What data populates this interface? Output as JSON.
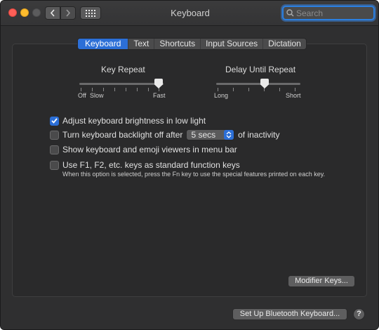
{
  "window": {
    "title": "Keyboard"
  },
  "search": {
    "placeholder": "Search"
  },
  "tabs": [
    {
      "label": "Keyboard",
      "active": true
    },
    {
      "label": "Text",
      "active": false
    },
    {
      "label": "Shortcuts",
      "active": false
    },
    {
      "label": "Input Sources",
      "active": false
    },
    {
      "label": "Dictation",
      "active": false
    }
  ],
  "key_repeat": {
    "title": "Key Repeat",
    "label_off": "Off",
    "label_slow": "Slow",
    "label_fast": "Fast",
    "level": "7 of 8"
  },
  "delay_until_repeat": {
    "title": "Delay Until Repeat",
    "label_long": "Long",
    "label_short": "Short",
    "level": "4 of 6"
  },
  "options": {
    "brightness": {
      "label": "Adjust keyboard brightness in low light",
      "checked": true
    },
    "backlight": {
      "label_before": "Turn keyboard backlight off after",
      "popup_value": "5 secs",
      "label_after": "of inactivity",
      "checked": false
    },
    "viewers": {
      "label": "Show keyboard and emoji viewers in menu bar",
      "checked": false
    },
    "fn_keys": {
      "label": "Use F1, F2, etc. keys as standard function keys",
      "note": "When this option is selected, press the Fn key to use the special features printed on each key.",
      "checked": false
    }
  },
  "buttons": {
    "modifier_keys": "Modifier Keys...",
    "bluetooth": "Set Up Bluetooth Keyboard...",
    "help": "?"
  },
  "colors": {
    "accent": "#2c6fd7",
    "window_bg": "#2f2f30"
  }
}
